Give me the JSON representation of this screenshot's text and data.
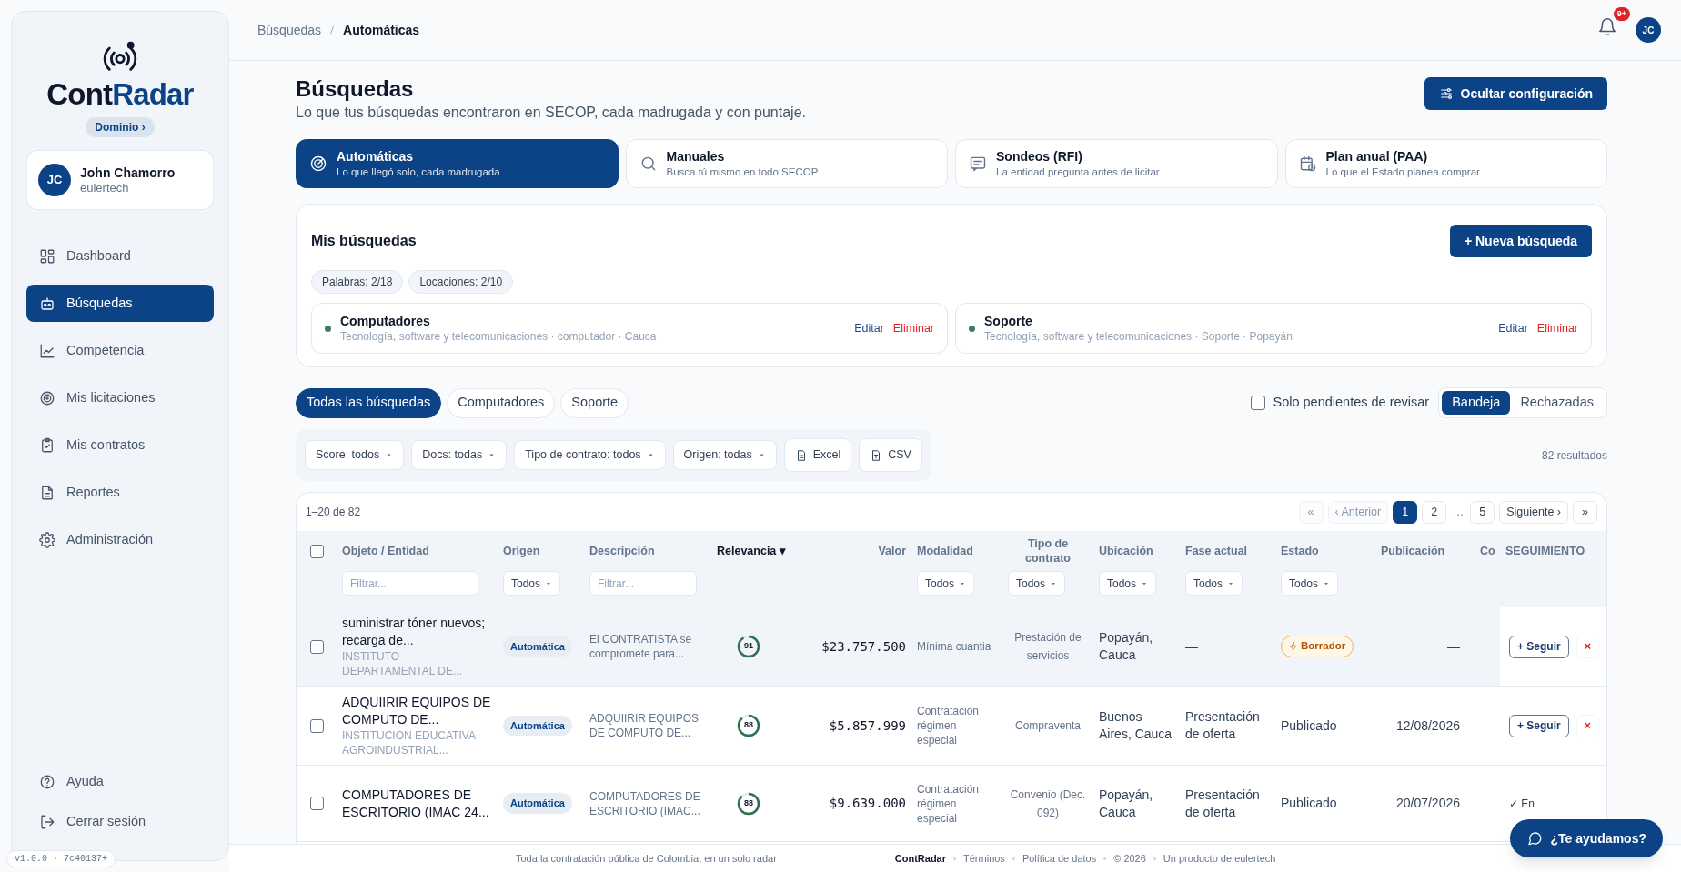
{
  "sidebar": {
    "logo_text": "Cont",
    "logo_accent": "Radar",
    "domain_button": "Dominio ›",
    "user": {
      "initials": "JC",
      "name": "John Chamorro",
      "org": "eulertech"
    },
    "items": [
      {
        "label": "Dashboard",
        "selected": false
      },
      {
        "label": "Búsquedas",
        "selected": true
      },
      {
        "label": "Competencia",
        "selected": false
      },
      {
        "label": "Mis licitaciones",
        "selected": false
      },
      {
        "label": "Mis contratos",
        "selected": false
      },
      {
        "label": "Reportes",
        "selected": false
      },
      {
        "label": "Administración",
        "selected": false
      }
    ],
    "bottom_items": [
      {
        "label": "Ayuda"
      },
      {
        "label": "Cerrar sesión"
      }
    ],
    "version": "v1.0.0 · 7c40137+"
  },
  "header": {
    "breadcrumb": [
      "Búsquedas",
      "Automáticas"
    ],
    "notifications": "9+",
    "avatar": "JC"
  },
  "page": {
    "title": "Búsquedas",
    "subtitle": "Lo que tus búsquedas encontraron en SECOP, cada madrugada y con puntaje.",
    "config_button": "Ocultar configuración"
  },
  "modes": [
    {
      "title": "Automáticas",
      "subtitle": "Lo que llegó solo, cada madrugada",
      "selected": true
    },
    {
      "title": "Manuales",
      "subtitle": "Busca tú mismo en todo SECOP",
      "selected": false
    },
    {
      "title": "Sondeos (RFI)",
      "subtitle": "La entidad pregunta antes de licitar",
      "selected": false
    },
    {
      "title": "Plan anual (PAA)",
      "subtitle": "Lo que el Estado planea comprar",
      "selected": false
    }
  ],
  "mis_busquedas": {
    "title": "Mis búsquedas",
    "new_button": "+ Nueva búsqueda",
    "quotas": [
      "Palabras: 2/18",
      "Locaciones: 2/10"
    ],
    "searches": [
      {
        "name": "Computadores",
        "details": "Tecnología, software y telecomunicaciones · computador · Cauca",
        "color": "#3f7a5e",
        "edit": "Editar",
        "delete": "Eliminar"
      },
      {
        "name": "Soporte",
        "details": "Tecnología, software y telecomunicaciones · Soporte · Popayán",
        "color": "#3f7a5e",
        "edit": "Editar",
        "delete": "Eliminar"
      }
    ]
  },
  "search_chips": [
    {
      "label": "Todas las búsquedas",
      "selected": true
    },
    {
      "label": "Computadores",
      "selected": false
    },
    {
      "label": "Soporte",
      "selected": false
    }
  ],
  "pending_only": {
    "label": "Solo pendientes de revisar",
    "checked": false
  },
  "views": [
    {
      "label": "Bandeja",
      "selected": true
    },
    {
      "label": "Rechazadas",
      "selected": false
    }
  ],
  "filters": [
    "Score: todos",
    "Docs: todas",
    "Tipo de contrato: todos",
    "Origen: todas"
  ],
  "exports": [
    "Excel",
    "CSV"
  ],
  "results_count": "82 resultados",
  "table": {
    "range": "1–20 de 82",
    "pagination": [
      {
        "kind": "nav",
        "label": "«",
        "disabled": true
      },
      {
        "kind": "nav",
        "label": "‹ Anterior",
        "disabled": true
      },
      {
        "kind": "page",
        "label": "1",
        "selected": true
      },
      {
        "kind": "page",
        "label": "2",
        "selected": false
      },
      {
        "kind": "ellipsis",
        "label": "…"
      },
      {
        "kind": "page",
        "label": "5",
        "selected": false
      },
      {
        "kind": "nav",
        "label": "Siguiente ›",
        "disabled": false
      },
      {
        "kind": "nav",
        "label": "»",
        "disabled": false
      }
    ],
    "select_all_checked": false,
    "columns": [
      {
        "label": "Objeto / Entidad",
        "placeholder": "Filtrar..."
      },
      {
        "label": "Origen",
        "dropdown": "Todos"
      },
      {
        "label": "Descripción",
        "placeholder": "Filtrar..."
      },
      {
        "label": "Relevancia ▾",
        "sorted": true
      },
      {
        "label": "Valor"
      },
      {
        "label": "Modalidad",
        "dropdown": "Todos"
      },
      {
        "label": "Tipo de contrato",
        "dropdown": "Todos"
      },
      {
        "label": "Ubicación",
        "dropdown": "Todos"
      },
      {
        "label": "Fase actual",
        "dropdown": "Todos"
      },
      {
        "label": "Estado",
        "dropdown": "Todos"
      },
      {
        "label": "Publicación"
      },
      {
        "label": "Co"
      },
      {
        "label": "SEGUIMIENTO"
      }
    ],
    "rows": [
      {
        "highlighted": true,
        "checked": false,
        "objeto": "suministrar tóner nuevos; recarga de...",
        "entidad": "INSTITUTO DEPARTAMENTAL DE...",
        "origen": "Automática",
        "descripcion": "El CONTRATISTA se compromete para...",
        "score": "91",
        "valor": "$23.757.500",
        "modalidad": "Mínima cuantia",
        "tipo": "Prestación de servicios",
        "ubicacion": "Popayán, Cauca",
        "fase": "—",
        "estado": {
          "kind": "badge",
          "text": "Borrador"
        },
        "publicacion": "—",
        "seguimiento": {
          "kind": "button",
          "text": "+ Seguir",
          "remove": "×"
        }
      },
      {
        "highlighted": false,
        "checked": false,
        "objeto": "ADQUIIRIR EQUIPOS DE COMPUTO DE...",
        "entidad": "INSTITUCION EDUCATIVA AGROINDUSTRIAL...",
        "origen": "Automática",
        "descripcion": "ADQUIIRIR EQUIPOS DE COMPUTO DE...",
        "score": "88",
        "valor": "$5.857.999",
        "modalidad": "Contratación régimen especial",
        "tipo": "Compraventa",
        "ubicacion": "Buenos Aires, Cauca",
        "fase": "Presentación de oferta",
        "estado": {
          "kind": "plain",
          "text": "Publicado"
        },
        "publicacion": "12/08/2026",
        "seguimiento": {
          "kind": "button",
          "text": "+ Seguir",
          "remove": "×"
        }
      },
      {
        "highlighted": false,
        "checked": false,
        "objeto": "COMPUTADORES DE ESCRITORIO (IMAC 24...",
        "origen": "Automática",
        "descripcion": "COMPUTADORES DE ESCRITORIO (IMAC...",
        "score": "88",
        "valor": "$9.639.000",
        "modalidad": "Contratación régimen especial",
        "tipo": "Convenio (Dec. 092)",
        "ubicacion": "Popayán, Cauca",
        "fase": "Presentación de oferta",
        "estado": {
          "kind": "plain",
          "text": "Publicado"
        },
        "publicacion": "20/07/2026",
        "seguimiento": {
          "kind": "following",
          "text": "✓ En"
        }
      }
    ]
  },
  "help_button": "¿Te ayudamos?",
  "footer": {
    "tagline": "Toda la contratación pública de Colombia, en un solo radar",
    "links": [
      "ContRadar",
      "Términos",
      "Política de datos",
      "© 2026",
      "Un producto de eulertech"
    ]
  }
}
